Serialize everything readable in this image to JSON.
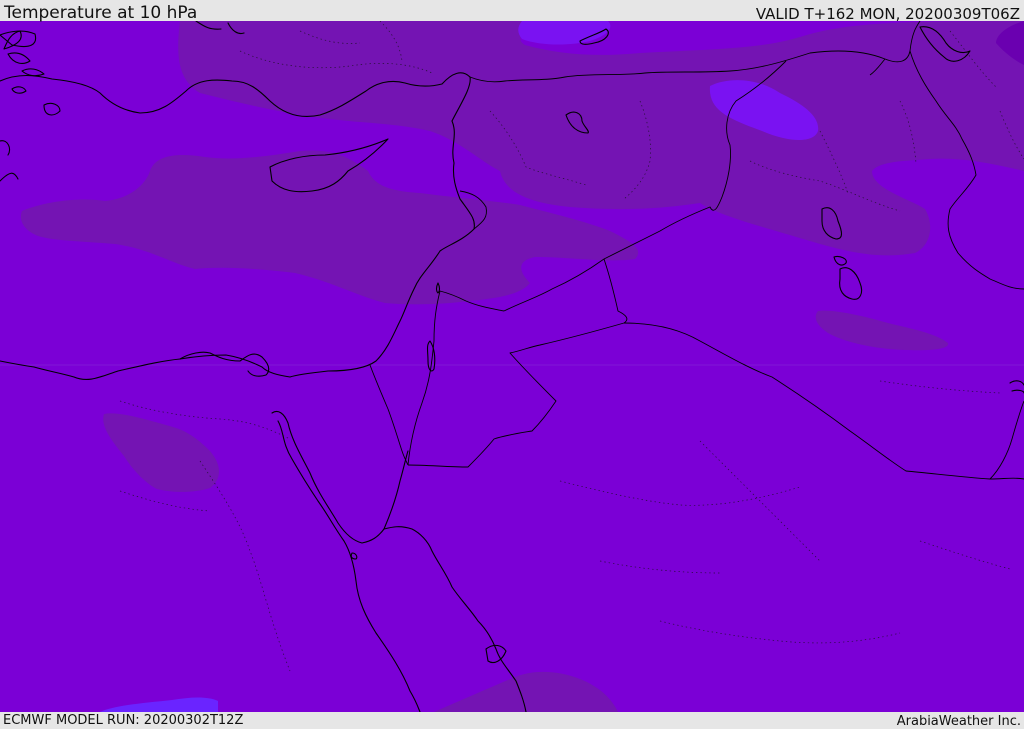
{
  "header": {
    "title": "Temperature at 10 hPa",
    "valid": "VALID T+162 MON, 20200309T06Z"
  },
  "footer": {
    "model_run": "ECMWF MODEL RUN: 20200302T12Z",
    "credit": "ArabiaWeather Inc."
  },
  "map": {
    "region": "Eastern Mediterranean and Middle East",
    "colors": {
      "base": "#7b00d6",
      "warm_patch": "#7414b3",
      "darkest_patch": "#6a00b0",
      "cool_patch": "#7a12f2",
      "blue_patch": "#6a24ff",
      "coastline": "#000000"
    }
  }
}
